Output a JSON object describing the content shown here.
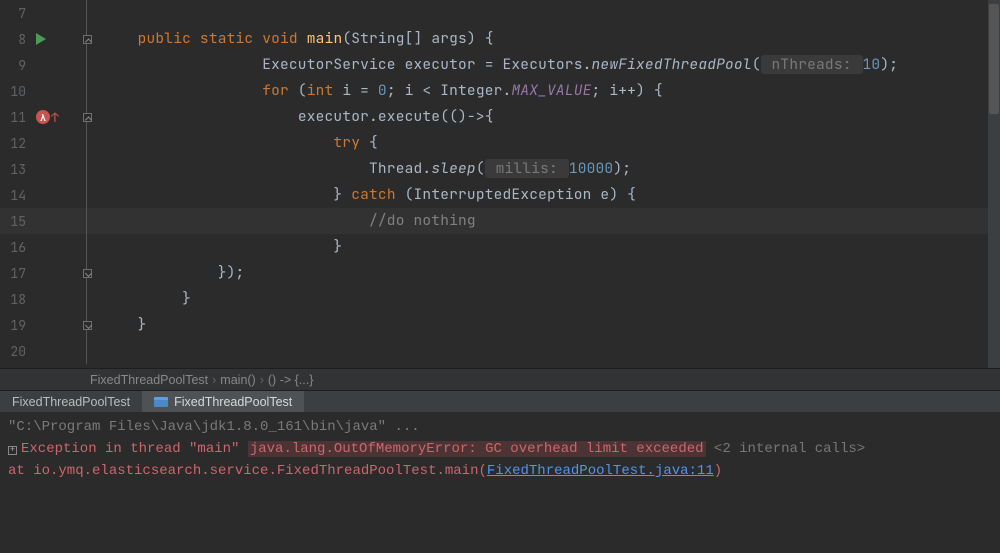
{
  "code": {
    "lines": [
      {
        "n": 7
      },
      {
        "n": 8
      },
      {
        "n": 9
      },
      {
        "n": 10
      },
      {
        "n": 11
      },
      {
        "n": 12
      },
      {
        "n": 13
      },
      {
        "n": 14
      },
      {
        "n": 15
      },
      {
        "n": 16
      },
      {
        "n": 17
      },
      {
        "n": 18
      },
      {
        "n": 19
      },
      {
        "n": 20
      }
    ],
    "tokens": {
      "l8_public": "public",
      "l8_static": "static",
      "l8_void": "void",
      "l8_main": "main",
      "l8_args": "(String[] args) {",
      "l9_a": "ExecutorService executor = Executors.",
      "l9_b": "newFixedThreadPool",
      "l9_hint": " nThreads: ",
      "l9_num": "10",
      "l9_end": ");",
      "l10_for": "for",
      "l10_int": "int",
      "l10_a": " i = ",
      "l10_zero": "0",
      "l10_b": "; i < Integer.",
      "l10_max": "MAX_VALUE",
      "l10_c": "; i++) {",
      "l11": "executor.execute(()->{",
      "l12_try": "try",
      "l12_brace": " {",
      "l13_a": "Thread.",
      "l13_sleep": "sleep",
      "l13_hint": " millis: ",
      "l13_num": "10000",
      "l13_end": ");",
      "l14_brace": "} ",
      "l14_catch": "catch",
      "l14_rest": " (InterruptedException e) {",
      "l15_comment": "//do nothing",
      "l16": "}",
      "l17": "});",
      "l18": "}",
      "l19": "}"
    }
  },
  "breadcrumbs": {
    "a": "FixedThreadPoolTest",
    "b": "main()",
    "c": "() -> {...}"
  },
  "tabs": {
    "a": "FixedThreadPoolTest",
    "b": "FixedThreadPoolTest"
  },
  "console": {
    "cmd": "\"C:\\Program Files\\Java\\jdk1.8.0_161\\bin\\java\" ...",
    "err1a": "Exception in thread \"main\" ",
    "err1b": "java.lang.OutOfMemoryError: GC overhead limit exceeded",
    "internal": " <2 internal calls>",
    "err2a": "    at io.ymq.elasticsearch.service.FixedThreadPoolTest.main(",
    "link": "FixedThreadPoolTest.java:11",
    "err2b": ")"
  }
}
